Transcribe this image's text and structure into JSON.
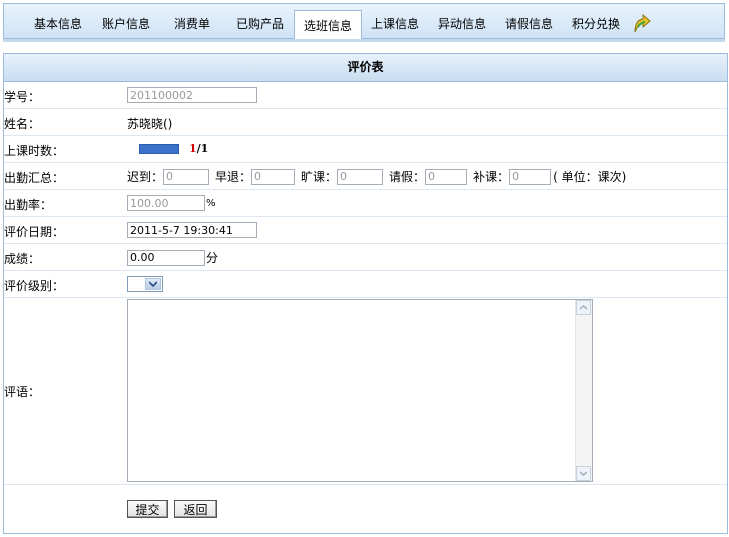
{
  "tabs": [
    {
      "label": "基本信息",
      "active": false
    },
    {
      "label": "账户信息",
      "active": false
    },
    {
      "label": "消费单",
      "active": false
    },
    {
      "label": "已购产品",
      "active": false
    },
    {
      "label": "选班信息",
      "active": true
    },
    {
      "label": "上课信息",
      "active": false
    },
    {
      "label": "异动信息",
      "active": false
    },
    {
      "label": "请假信息",
      "active": false
    },
    {
      "label": "积分兑换",
      "active": false
    }
  ],
  "tab_icon": "refresh-arrow-icon",
  "form": {
    "title": "评价表",
    "student_id": {
      "label": "学号：",
      "value": "201100002"
    },
    "name": {
      "label": "姓名：",
      "value": "苏晓晓()"
    },
    "sessions": {
      "label": "上课时数：",
      "done": "1",
      "total": "/1",
      "progress": 1.0
    },
    "attendance": {
      "label": "出勤汇总：",
      "late_label": "迟到：",
      "late_value": "0",
      "early_label": "早退：",
      "early_value": "0",
      "absent_label": "旷课：",
      "absent_value": "0",
      "leave_label": "请假：",
      "leave_value": "0",
      "makeup_label": "补课：",
      "makeup_value": "0",
      "unit_text": "( 单位：课次)"
    },
    "attendance_rate": {
      "label": "出勤率：",
      "value": "100.00",
      "unit": "%"
    },
    "eval_date": {
      "label": "评价日期：",
      "value": "2011-5-7 19:30:41"
    },
    "score": {
      "label": "成绩：",
      "value": "0.00",
      "unit": "分"
    },
    "level": {
      "label": "评价级别：",
      "value": ""
    },
    "comment": {
      "label": "评语：",
      "value": ""
    },
    "submit_label": "提交",
    "back_label": "返回"
  },
  "colors": {
    "accent": "#3a73c9",
    "border": "#9dbbdb",
    "header_bg": "#cfe3f6"
  }
}
